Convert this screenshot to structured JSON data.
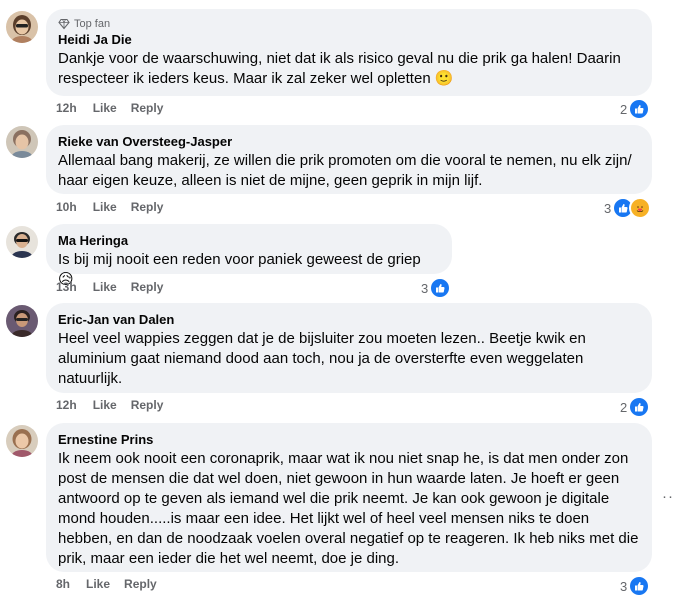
{
  "comments": [
    {
      "author": "Heidi Ja Die",
      "badge": "Top fan",
      "lines": [
        "Dankje voor de waarschuwing, niet dat ik als risico geval nu die prik ga halen! Daarin",
        "respecteer ik ieders keus. Maar ik zal zeker wel opletten 🙂"
      ],
      "time": "12h",
      "like_label": "Like",
      "reply_label": "Reply",
      "reaction_count": "2",
      "reactions": [
        "like-icon"
      ],
      "avatar_color": "#c9a98a"
    },
    {
      "author": "Rieke van Oversteeg-Jasper",
      "lines": [
        "Allemaal bang makerij, ze willen die prik promoten om die vooral te nemen, nu elk zijn/",
        "haar eigen keuze, alleen is niet de mijne, geen geprik in mijn lijf."
      ],
      "time": "10h",
      "like_label": "Like",
      "reply_label": "Reply",
      "reaction_count": "3",
      "reactions": [
        "like-icon",
        "care-icon"
      ],
      "avatar_color": "#a08a7a"
    },
    {
      "author": "Ma Heringa",
      "lines": [
        "Is bij mij nooit een reden voor paniek geweest de griep 😥"
      ],
      "time": "13h",
      "like_label": "Like",
      "reply_label": "Reply",
      "reaction_count": "3",
      "reactions": [
        "like-icon"
      ],
      "avatar_color": "#3b3f55"
    },
    {
      "author": "Eric-Jan van Dalen",
      "lines": [
        "Heel veel wappies zeggen dat je de bijsluiter zou moeten lezen.. Beetje kwik en",
        "aluminium gaat niemand dood aan toch, nou ja de oversterfte even weggelaten",
        "natuurlijk."
      ],
      "time": "12h",
      "like_label": "Like",
      "reply_label": "Reply",
      "reaction_count": "2",
      "reactions": [
        "like-icon"
      ],
      "avatar_color": "#5a4a6a"
    },
    {
      "author": "Ernestine Prins",
      "lines": [
        "Ik neem ook nooit een coronaprik, maar wat ik nou niet snap he, is dat men onder zon",
        "post de mensen die dat wel doen, niet gewoon in hun waarde laten. Je hoeft er geen",
        "antwoord op te geven als iemand wel die prik neemt. Je kan ook gewoon je digitale",
        "mond houden.....is maar een idee. Het lijkt wel of heel veel mensen niks te doen",
        "hebben, en dan de noodzaak voelen overal negatief op te reageren. Ik heb niks met die",
        "prik, maar een ieder die het wel neemt, doe je ding."
      ],
      "time": "8h",
      "like_label": "Like",
      "reply_label": "Reply",
      "reaction_count": "3",
      "reactions": [
        "like-icon"
      ],
      "avatar_color": "#b89a80"
    }
  ],
  "more_icon": "more-options-icon"
}
